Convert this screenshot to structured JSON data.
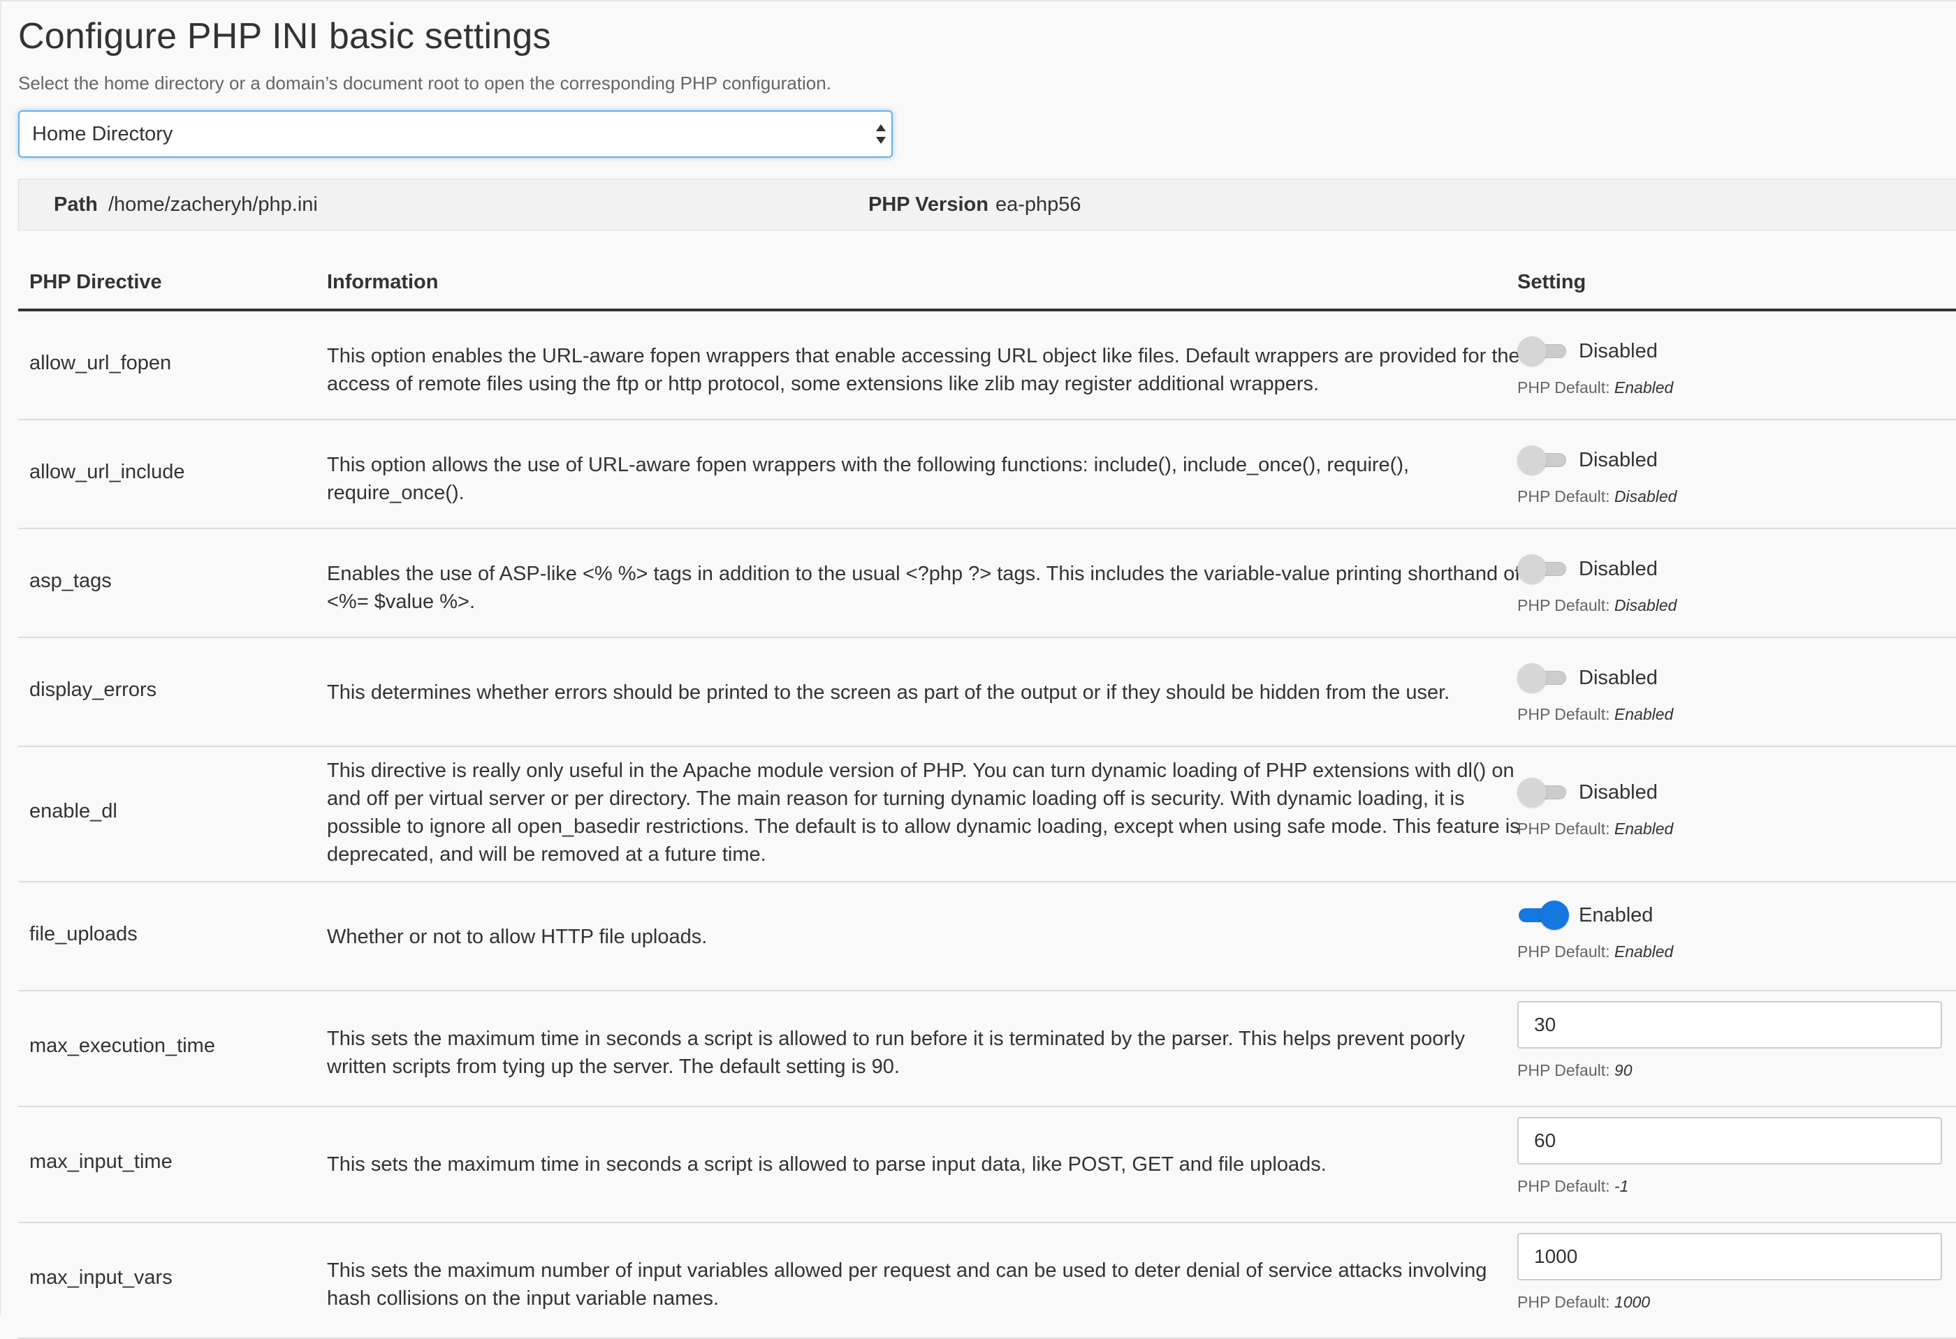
{
  "page": {
    "title": "Configure PHP INI basic settings",
    "description": "Select the home directory or a domain’s document root to open the corresponding PHP configuration."
  },
  "location_select": {
    "selected": "Home Directory"
  },
  "info_bar": {
    "path_label": "Path",
    "path_value": "/home/zacheryh/php.ini",
    "version_label": "PHP Version",
    "version_value": "ea-php56"
  },
  "table": {
    "headers": {
      "directive": "PHP Directive",
      "information": "Information",
      "setting": "Setting"
    },
    "default_prefix": "PHP Default:",
    "rows": [
      {
        "directive": "allow_url_fopen",
        "information": "This option enables the URL-aware fopen wrappers that enable accessing URL object like files. Default wrappers are provided for the access of remote files using the ftp or http protocol, some extensions like zlib may register additional wrappers.",
        "type": "toggle",
        "state": "off",
        "state_label": "Disabled",
        "default": "Enabled"
      },
      {
        "directive": "allow_url_include",
        "information": "This option allows the use of URL-aware fopen wrappers with the following functions: include(), include_once(), require(), require_once().",
        "type": "toggle",
        "state": "off",
        "state_label": "Disabled",
        "default": "Disabled"
      },
      {
        "directive": "asp_tags",
        "information": "Enables the use of ASP-like <% %> tags in addition to the usual <?php ?> tags. This includes the variable-value printing shorthand of <%= $value %>.",
        "type": "toggle",
        "state": "off",
        "state_label": "Disabled",
        "default": "Disabled"
      },
      {
        "directive": "display_errors",
        "information": "This determines whether errors should be printed to the screen as part of the output or if they should be hidden from the user.",
        "type": "toggle",
        "state": "off",
        "state_label": "Disabled",
        "default": "Enabled"
      },
      {
        "directive": "enable_dl",
        "information": "This directive is really only useful in the Apache module version of PHP. You can turn dynamic loading of PHP extensions with dl() on and off per virtual server or per directory. The main reason for turning dynamic loading off is security. With dynamic loading, it is possible to ignore all open_basedir restrictions. The default is to allow dynamic loading, except when using safe mode. This feature is deprecated, and will be removed at a future time.",
        "type": "toggle",
        "state": "off",
        "state_label": "Disabled",
        "default": "Enabled"
      },
      {
        "directive": "file_uploads",
        "information": "Whether or not to allow HTTP file uploads.",
        "type": "toggle",
        "state": "on",
        "state_label": "Enabled",
        "default": "Enabled"
      },
      {
        "directive": "max_execution_time",
        "information": "This sets the maximum time in seconds a script is allowed to run before it is terminated by the parser. This helps prevent poorly written scripts from tying up the server. The default setting is 90.",
        "type": "input",
        "value": "30",
        "default": "90"
      },
      {
        "directive": "max_input_time",
        "information": "This sets the maximum time in seconds a script is allowed to parse input data, like POST, GET and file uploads.",
        "type": "input",
        "value": "60",
        "default": "-1"
      },
      {
        "directive": "max_input_vars",
        "information": "This sets the maximum number of input variables allowed per request and can be used to deter denial of service attacks involving hash collisions on the input variable names.",
        "type": "input",
        "value": "1000",
        "default": "1000"
      }
    ]
  }
}
